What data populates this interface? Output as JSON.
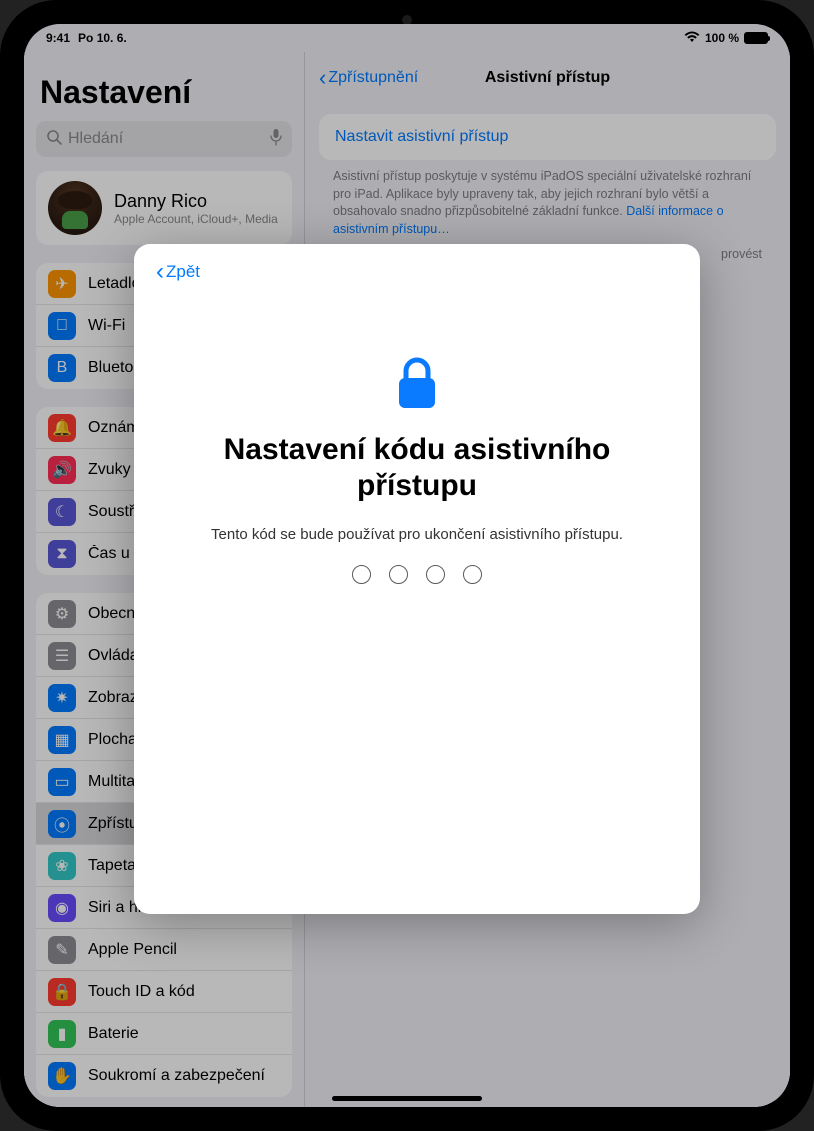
{
  "status": {
    "time": "9:41",
    "date": "Po 10. 6.",
    "wifi": "􀙇",
    "battery_pct": "100 %"
  },
  "sidebar": {
    "title": "Nastavení",
    "search_placeholder": "Hledání",
    "profile": {
      "name": "Danny Rico",
      "subtitle": "Apple Account, iCloud+, Media"
    },
    "group1": [
      {
        "label": "Letadlo",
        "color": "#ff9500",
        "glyph": "✈"
      },
      {
        "label": "Wi-Fi",
        "color": "#007aff",
        "glyph": "􀙇"
      },
      {
        "label": "Bluetooth",
        "color": "#007aff",
        "glyph": "B"
      }
    ],
    "group2": [
      {
        "label": "Oznámení",
        "color": "#ff3b30",
        "glyph": "🔔"
      },
      {
        "label": "Zvuky",
        "color": "#ff2d55",
        "glyph": "🔊"
      },
      {
        "label": "Soustředění",
        "color": "#5856d6",
        "glyph": "☾"
      },
      {
        "label": "Čas u obrazovky",
        "color": "#5856d6",
        "glyph": "⧗"
      }
    ],
    "group3": [
      {
        "label": "Obecné",
        "color": "#8e8e93",
        "glyph": "⚙"
      },
      {
        "label": "Ovládací centrum",
        "color": "#8e8e93",
        "glyph": "☰"
      },
      {
        "label": "Zobrazení a jas",
        "color": "#007aff",
        "glyph": "✷"
      },
      {
        "label": "Plocha a Dock",
        "color": "#007aff",
        "glyph": "▦"
      },
      {
        "label": "Multitasking",
        "color": "#007aff",
        "glyph": "▭"
      },
      {
        "label": "Zpřístupnění",
        "color": "#007aff",
        "glyph": "⦿",
        "selected": true
      },
      {
        "label": "Tapeta",
        "color": "#34c8c8",
        "glyph": "❀"
      },
      {
        "label": "Siri a hledání",
        "color": "#6a4cff",
        "glyph": "◉"
      },
      {
        "label": "Apple Pencil",
        "color": "#8e8e93",
        "glyph": "✎"
      },
      {
        "label": "Touch ID a kód",
        "color": "#ff3b30",
        "glyph": "🔒"
      },
      {
        "label": "Baterie",
        "color": "#34c759",
        "glyph": "▮"
      },
      {
        "label": "Soukromí a zabezpečení",
        "color": "#007aff",
        "glyph": "✋"
      }
    ]
  },
  "detail": {
    "back_label": "Zpřístupnění",
    "title": "Asistivní přístup",
    "action": "Nastavit asistivní přístup",
    "description_pre": "Asistivní přístup poskytuje v systému iPadOS speciální uživatelské rozhraní pro iPad. Aplikace byly upraveny tak, aby jejich rozhraní bylo větší a obsahovalo snadno přizpůsobitelné základní funkce. ",
    "description_link": "Další informace o asistivním přístupu…",
    "trailing": "provést"
  },
  "modal": {
    "back_label": "Zpět",
    "title": "Nastavení kódu asistivního přístupu",
    "description": "Tento kód se bude používat pro ukončení asistivního přístupu."
  }
}
